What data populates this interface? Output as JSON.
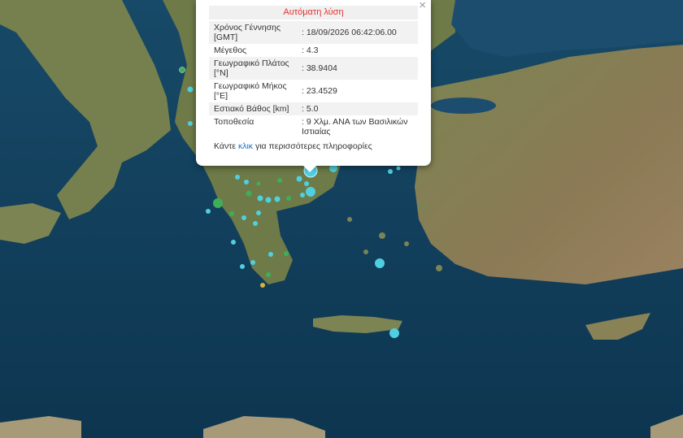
{
  "popup": {
    "title": "Αυτόματη λύση",
    "close": "×",
    "rows": [
      {
        "label": "Χρόνος Γέννησης [GMT]",
        "value": ": 18/09/2026 06:42:06.00"
      },
      {
        "label": "Μέγεθος",
        "value": ": 4.3"
      },
      {
        "label": "Γεωγραφικό Πλάτος [°N]",
        "value": ": 38.9404"
      },
      {
        "label": "Γεωγραφικό Μήκος [°E]",
        "value": ": 23.4529"
      },
      {
        "label": "Εστιακό Βάθος [km]",
        "value": ": 5.0"
      },
      {
        "label": "Τοποθεσία",
        "value": ": 9 Χλμ. ΑΝΑ των Βασιλικών Ιστιαίας"
      }
    ],
    "more_prefix": "Κάντε ",
    "more_link": "κλικ",
    "more_suffix": " για περισσότερες πληροφορίες"
  },
  "colors": {
    "popup_title": "#e03030",
    "link": "#1a6fc4",
    "sea": "#0f3a57",
    "land": "#6f7a4a",
    "marker_cyan": "#4fd0e0",
    "marker_green": "#3fae5a",
    "marker_yellow": "#d8b23a"
  }
}
